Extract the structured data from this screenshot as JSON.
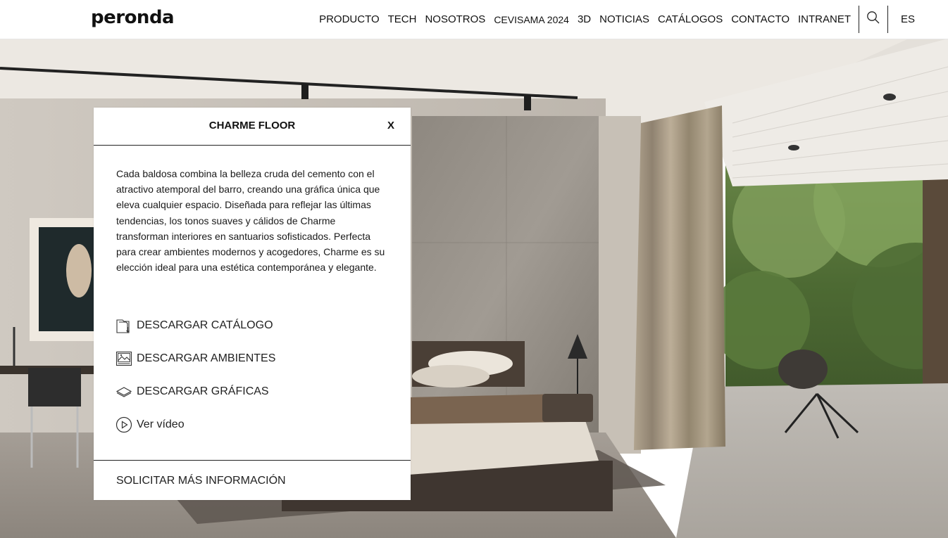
{
  "brand": {
    "logo_text": "peronda"
  },
  "nav": {
    "items": [
      {
        "label": "PRODUCTO"
      },
      {
        "label": "TECH"
      },
      {
        "label": "NOSOTROS"
      },
      {
        "label": "CEVISAMA 2024"
      },
      {
        "label": "3D"
      },
      {
        "label": "NOTICIAS"
      },
      {
        "label": "CATÁLOGOS"
      },
      {
        "label": "CONTACTO"
      },
      {
        "label": "INTRANET"
      }
    ],
    "search_icon": "search-icon",
    "language": "ES"
  },
  "modal": {
    "title": "CHARME FLOOR",
    "close_label": "X",
    "description": "Cada baldosa combina la belleza cruda del cemento con el atractivo atemporal del barro, creando una gráfica única que eleva cualquier espacio. Diseñada para reflejar las últimas tendencias, los tonos suaves y cálidos de Charme transforman interiores en santuarios sofisticados. Perfecta para crear ambientes modernos y acogedores, Charme es su elección ideal para una estética contemporánea y elegante.",
    "actions": [
      {
        "label": "DESCARGAR CATÁLOGO",
        "icon": "catalog-download-icon"
      },
      {
        "label": "DESCARGAR AMBIENTES",
        "icon": "image-icon"
      },
      {
        "label": "DESCARGAR GRÁFICAS",
        "icon": "tile-layers-icon"
      },
      {
        "label": "Ver vídeo",
        "icon": "play-icon"
      }
    ],
    "footer_link": "SOLICITAR MÁS INFORMACIÓN"
  },
  "colors": {
    "text": "#222222",
    "background": "#ffffff",
    "divider": "#222222"
  }
}
